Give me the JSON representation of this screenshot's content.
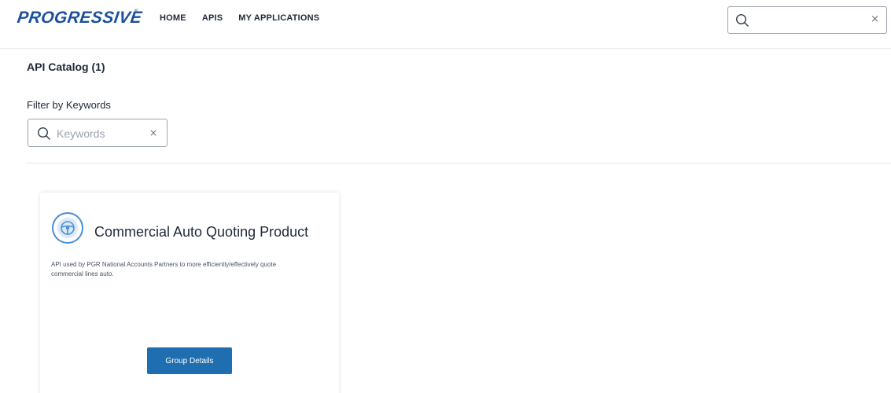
{
  "header": {
    "logo_text": "PROGRESSIVE",
    "logo_mark": "®",
    "nav": [
      {
        "label": "HOME"
      },
      {
        "label": "APIS"
      },
      {
        "label": "MY APPLICATIONS"
      }
    ],
    "search": {
      "value": "",
      "placeholder": "",
      "clear": "×",
      "icon": "search-icon"
    }
  },
  "catalog": {
    "title": "API Catalog (1)"
  },
  "filter": {
    "label": "Filter by Keywords",
    "placeholder": "Keywords",
    "value": "",
    "clear": "×"
  },
  "cards": [
    {
      "icon": "steering-wheel-icon",
      "title": "Commercial Auto Quoting Product",
      "description": "API used by PGR National Accounts Partners to more efficiently/effectively quote commercial lines auto.",
      "button_label": "Group Details"
    }
  ],
  "colors": {
    "brand": "#1b4f9c",
    "button": "#1f6fb0",
    "icon_ring": "#4a8ed8"
  }
}
